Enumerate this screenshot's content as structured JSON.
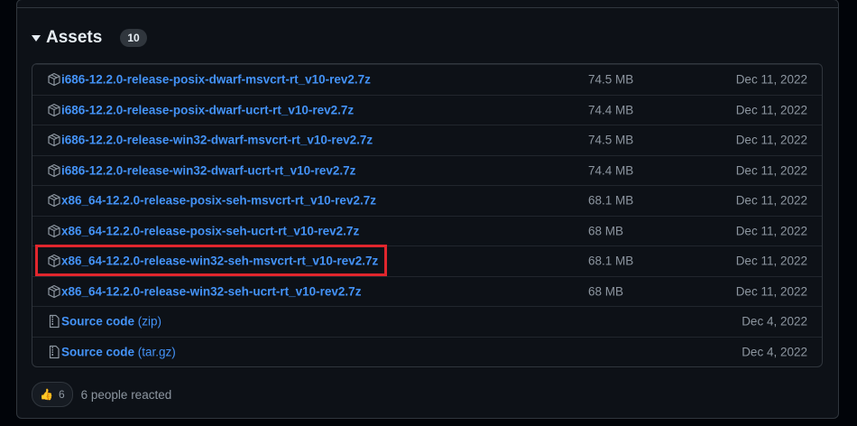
{
  "assets": {
    "title": "Assets",
    "count": "10",
    "items": [
      {
        "name": "i686-12.2.0-release-posix-dwarf-msvcrt-rt_v10-rev2.7z",
        "suffix": "",
        "size": "74.5 MB",
        "date": "Dec 11, 2022",
        "icon": "package-icon"
      },
      {
        "name": "i686-12.2.0-release-posix-dwarf-ucrt-rt_v10-rev2.7z",
        "suffix": "",
        "size": "74.4 MB",
        "date": "Dec 11, 2022",
        "icon": "package-icon"
      },
      {
        "name": "i686-12.2.0-release-win32-dwarf-msvcrt-rt_v10-rev2.7z",
        "suffix": "",
        "size": "74.5 MB",
        "date": "Dec 11, 2022",
        "icon": "package-icon"
      },
      {
        "name": "i686-12.2.0-release-win32-dwarf-ucrt-rt_v10-rev2.7z",
        "suffix": "",
        "size": "74.4 MB",
        "date": "Dec 11, 2022",
        "icon": "package-icon"
      },
      {
        "name": "x86_64-12.2.0-release-posix-seh-msvcrt-rt_v10-rev2.7z",
        "suffix": "",
        "size": "68.1 MB",
        "date": "Dec 11, 2022",
        "icon": "package-icon"
      },
      {
        "name": "x86_64-12.2.0-release-posix-seh-ucrt-rt_v10-rev2.7z",
        "suffix": "",
        "size": "68 MB",
        "date": "Dec 11, 2022",
        "icon": "package-icon"
      },
      {
        "name": "x86_64-12.2.0-release-win32-seh-msvcrt-rt_v10-rev2.7z",
        "suffix": "",
        "size": "68.1 MB",
        "date": "Dec 11, 2022",
        "icon": "package-icon"
      },
      {
        "name": "x86_64-12.2.0-release-win32-seh-ucrt-rt_v10-rev2.7z",
        "suffix": "",
        "size": "68 MB",
        "date": "Dec 11, 2022",
        "icon": "package-icon"
      },
      {
        "name": "Source code",
        "suffix": " (zip)",
        "size": "",
        "date": "Dec 4, 2022",
        "icon": "file-zip-icon"
      },
      {
        "name": "Source code",
        "suffix": " (tar.gz)",
        "size": "",
        "date": "Dec 4, 2022",
        "icon": "file-zip-icon"
      }
    ],
    "highlighted_index": 6
  },
  "reactions": {
    "emoji": "👍",
    "count": "6",
    "text": "6 people reacted"
  },
  "colors": {
    "link": "#4493f8",
    "muted": "#8d96a0",
    "highlight": "#e1262d",
    "background": "#0d1117",
    "border": "#30363d"
  }
}
